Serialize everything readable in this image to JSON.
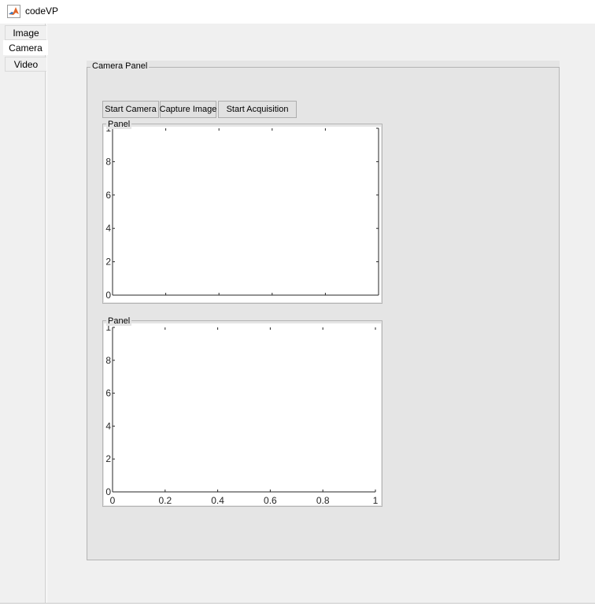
{
  "window": {
    "title": "codeVP",
    "icon": "matlab-logo-icon"
  },
  "tabs": [
    {
      "label": "Image",
      "selected": false
    },
    {
      "label": "Camera",
      "selected": true
    },
    {
      "label": "Video",
      "selected": false
    }
  ],
  "camera_panel": {
    "title": "Camera Panel",
    "buttons": {
      "start_camera": "Start Camera",
      "capture_image": "Capture Image",
      "start_acquisition": "Start Acquisition"
    },
    "panel1": {
      "title": "Panel",
      "y_ticks": [
        "1",
        "8",
        "6",
        "4",
        "2",
        "0"
      ],
      "x_ticks": []
    },
    "panel2": {
      "title": "Panel",
      "y_ticks": [
        "1",
        "8",
        "6",
        "4",
        "2",
        "0"
      ],
      "x_ticks": [
        "0",
        "0.2",
        "0.4",
        "0.6",
        "0.8",
        "1"
      ]
    }
  },
  "colors": {
    "window_bg": "#f0f0f0",
    "panel_bg": "#e5e5e5",
    "axes_bg": "#ffffff",
    "axis_line": "#262626",
    "button_bg": "#e1e1e1"
  }
}
